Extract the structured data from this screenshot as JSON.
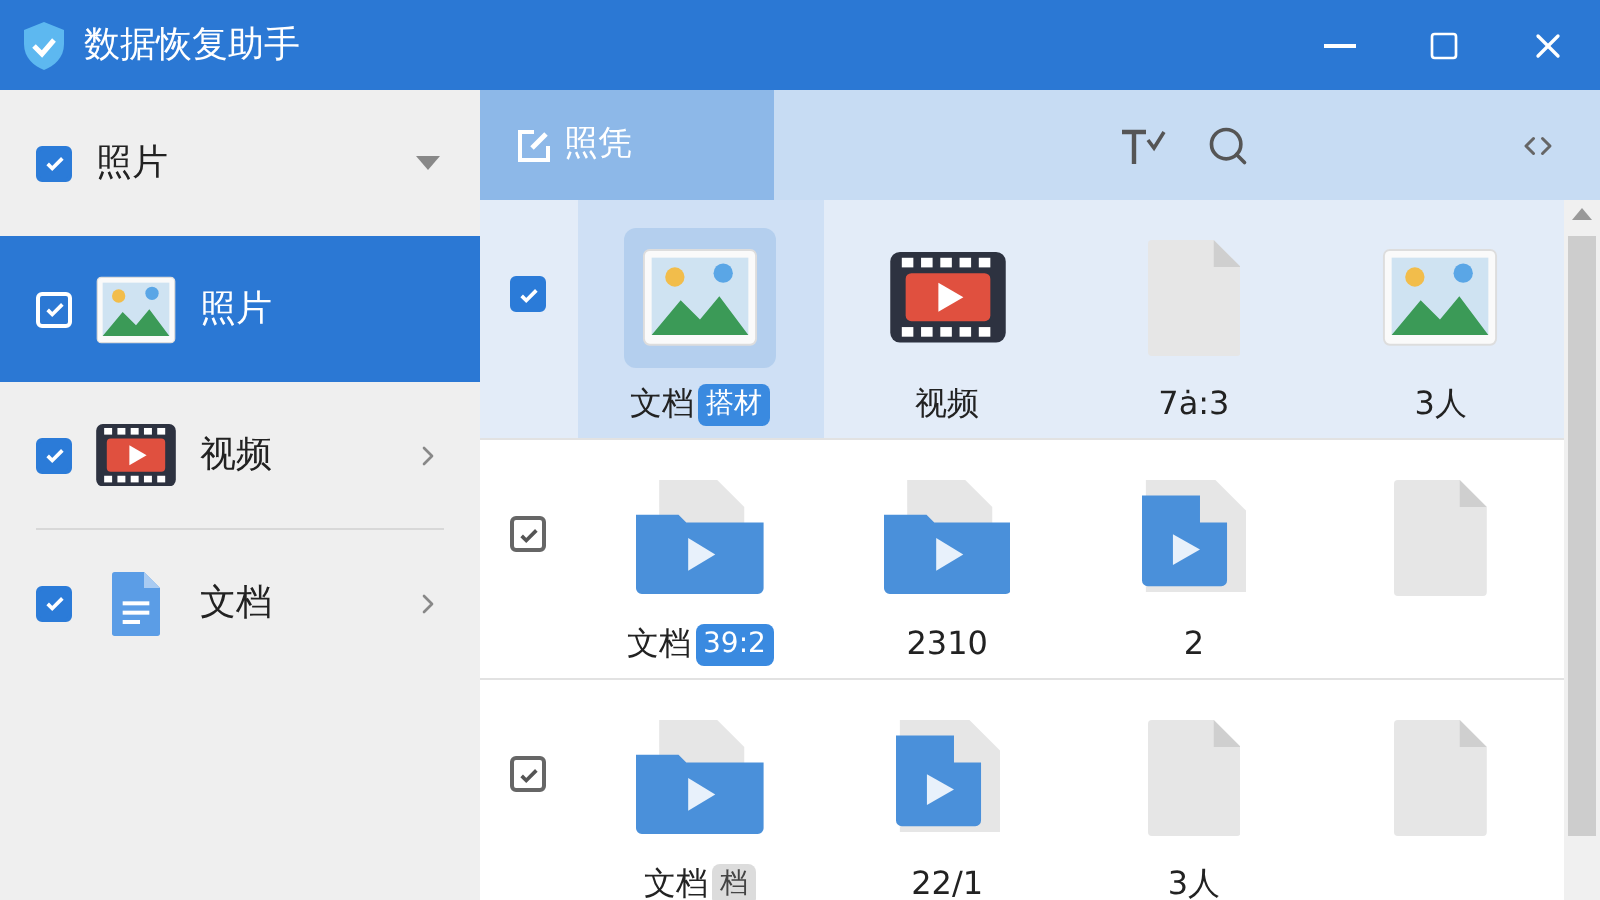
{
  "window": {
    "title": "数据恢复助手"
  },
  "sidebar": {
    "header": {
      "label": "照片",
      "checked": true
    },
    "items": [
      {
        "label": "照片",
        "kind": "image",
        "checked": true,
        "selected": true
      },
      {
        "label": "视频",
        "kind": "film",
        "checked": true,
        "selected": false
      },
      {
        "label": "文档",
        "kind": "doc",
        "checked": true,
        "selected": false
      }
    ]
  },
  "toolbar": {
    "tab": {
      "label": "照凭",
      "selected": true
    }
  },
  "rows": [
    {
      "checked": true,
      "selected": true,
      "tiles": [
        {
          "kind": "image",
          "label": "文档",
          "badge": "搭材",
          "selected": true
        },
        {
          "kind": "film",
          "label": "视频",
          "selected": false
        },
        {
          "kind": "blank",
          "label": "7ȧ:3",
          "selected": false
        },
        {
          "kind": "image",
          "label": "3人",
          "selected": false
        }
      ]
    },
    {
      "checked": true,
      "selected": false,
      "tiles": [
        {
          "kind": "folder",
          "label": "文档",
          "badge": "39:2",
          "selected": false
        },
        {
          "kind": "folder",
          "label": "2310",
          "selected": false
        },
        {
          "kind": "filevideo",
          "label": "2",
          "selected": false
        },
        {
          "kind": "blank",
          "selected": false
        }
      ]
    },
    {
      "checked": true,
      "selected": false,
      "tiles": [
        {
          "kind": "folder",
          "label": "文档",
          "badge": "档",
          "selected": false
        },
        {
          "kind": "filevideo",
          "label": "22/1",
          "selected": false
        },
        {
          "kind": "blank",
          "label": "3人",
          "selected": false
        },
        {
          "kind": "blank",
          "selected": false
        }
      ]
    }
  ]
}
